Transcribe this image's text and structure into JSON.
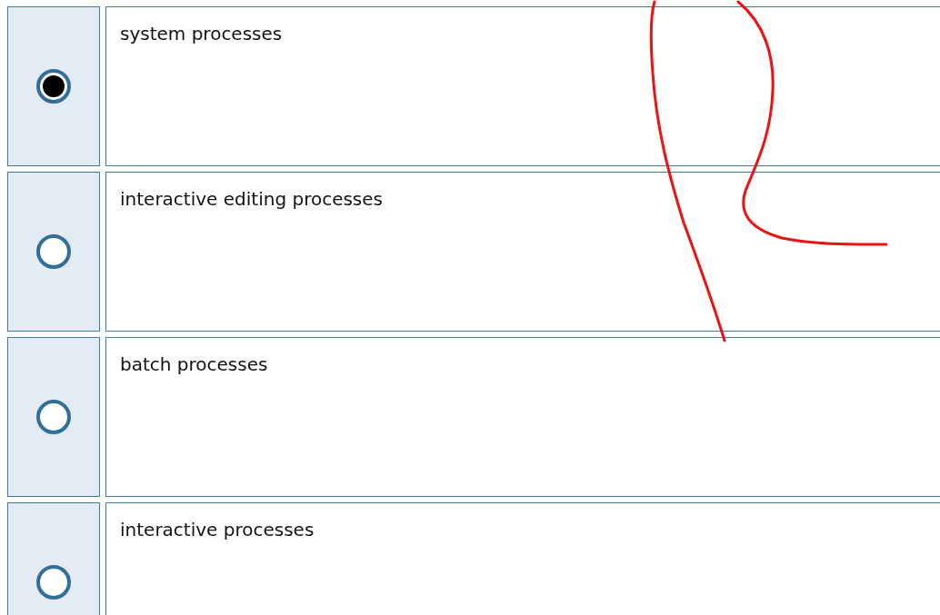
{
  "options": [
    {
      "label": "system processes",
      "selected": true
    },
    {
      "label": "interactive editing processes",
      "selected": false
    },
    {
      "label": "batch processes",
      "selected": false
    },
    {
      "label": "interactive processes",
      "selected": false
    }
  ]
}
